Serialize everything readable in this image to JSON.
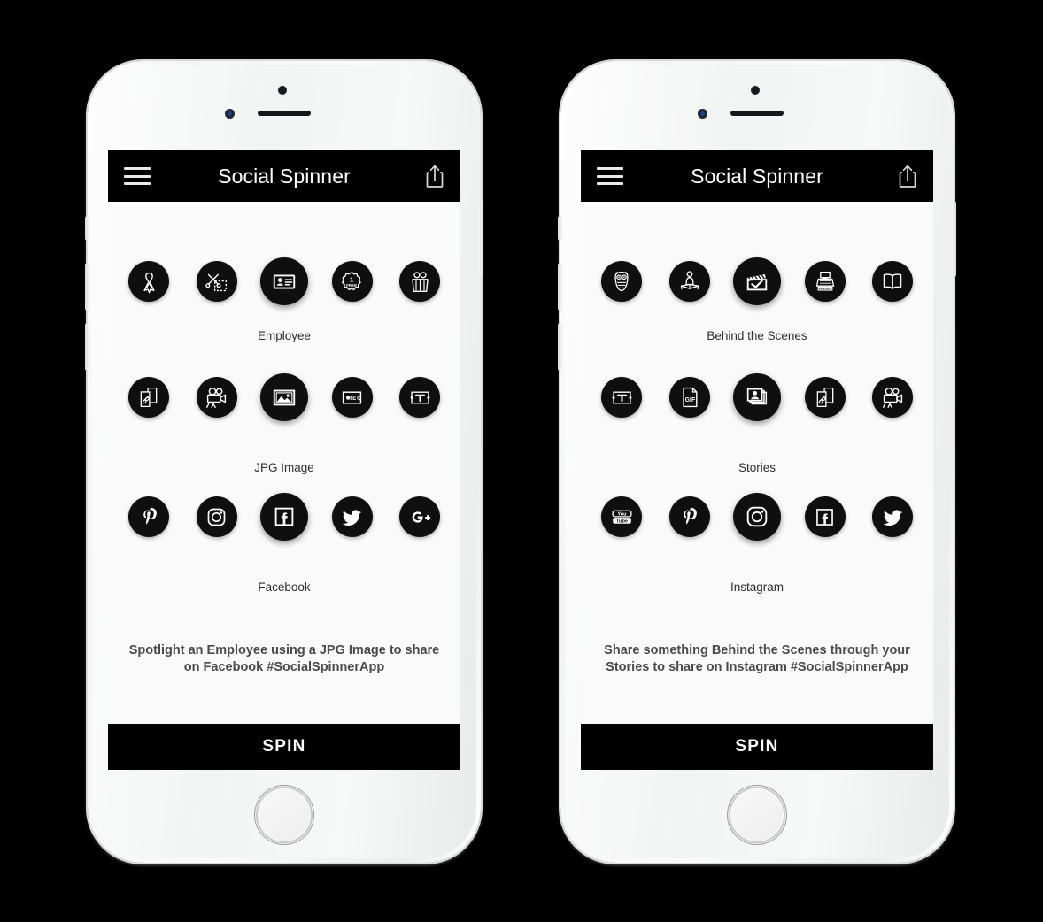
{
  "background_color": "#000000",
  "phones": [
    {
      "id": "left",
      "navbar": {
        "title": "Social Spinner",
        "menu_icon": "hamburger-icon",
        "share_icon": "share-icon"
      },
      "rows": [
        {
          "label": "Employee",
          "selected_index": 2,
          "icons": [
            "ribbon-icon",
            "scissors-cut-icon",
            "id-badge-card-icon",
            "one-free-badge-icon",
            "team-people-icon"
          ]
        },
        {
          "label": "JPG Image",
          "selected_index": 2,
          "icons": [
            "link-document-icon",
            "video-camera-icon",
            "picture-frame-icon",
            "rec-record-icon",
            "text-tool-icon"
          ]
        },
        {
          "label": "Facebook",
          "selected_index": 2,
          "icons": [
            "pinterest-icon",
            "instagram-icon",
            "facebook-icon",
            "twitter-icon",
            "googleplus-icon"
          ]
        }
      ],
      "caption": "Spotlight an Employee using a JPG Image to share on Facebook #SocialSpinnerApp",
      "spin_label": "SPIN"
    },
    {
      "id": "right",
      "navbar": {
        "title": "Social Spinner",
        "menu_icon": "hamburger-icon",
        "share_icon": "share-icon"
      },
      "rows": [
        {
          "label": "Behind the Scenes",
          "selected_index": 2,
          "icons": [
            "owl-icon",
            "person-reading-icon",
            "clapperboard-icon",
            "typewriter-icon",
            "open-book-icon"
          ]
        },
        {
          "label": "Stories",
          "selected_index": 2,
          "icons": [
            "text-tool-icon",
            "gif-file-icon",
            "photo-stack-icon",
            "link-document-icon",
            "video-camera-icon"
          ]
        },
        {
          "label": "Instagram",
          "selected_index": 2,
          "icons": [
            "youtube-icon",
            "pinterest-icon",
            "instagram-icon",
            "facebook-icon",
            "twitter-icon"
          ]
        }
      ],
      "caption": "Share something Behind the Scenes through your Stories to share on Instagram #SocialSpinnerApp",
      "spin_label": "SPIN"
    }
  ]
}
